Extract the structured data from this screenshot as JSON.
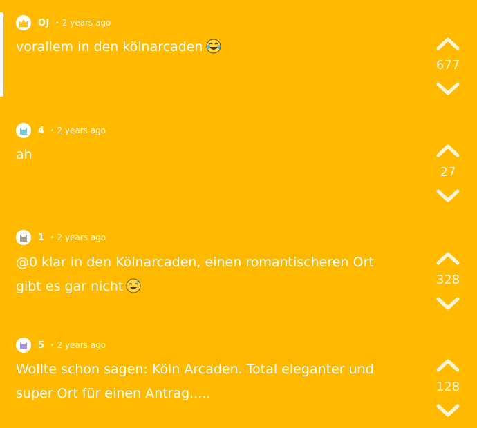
{
  "colors": {
    "background": "#FFBA00",
    "text": "#FFFFFF"
  },
  "comments": [
    {
      "username": "OJ",
      "separator": "•",
      "time": "2 years ago",
      "text": "vorallem in den kölnarcaden",
      "emoji": "laughing-tears-emoji",
      "score": "677",
      "avatar_icon": "crown-icon",
      "avatar_color": "#FFC21A"
    },
    {
      "username": "4",
      "separator": "•",
      "time": "2 years ago",
      "text": "ah",
      "emoji": "",
      "score": "27",
      "avatar_icon": "cat-icon",
      "avatar_color": "#7FC8D9"
    },
    {
      "username": "1",
      "separator": "•",
      "time": "2 years ago",
      "text": "@0 klar in den Kölnarcaden, einen romantischeren Ort gibt es gar nicht",
      "emoji": "sweat-smile-emoji",
      "score": "328",
      "avatar_icon": "cat-icon",
      "avatar_color": "#A89A8C"
    },
    {
      "username": "5",
      "separator": "•",
      "time": "2 years ago",
      "text": "Wollte schon sagen: Köln Arcaden. Total eleganter und super Ort für einen Antrag.....",
      "emoji": "",
      "score": "128",
      "avatar_icon": "cat-icon",
      "avatar_color": "#A98ED6"
    }
  ]
}
